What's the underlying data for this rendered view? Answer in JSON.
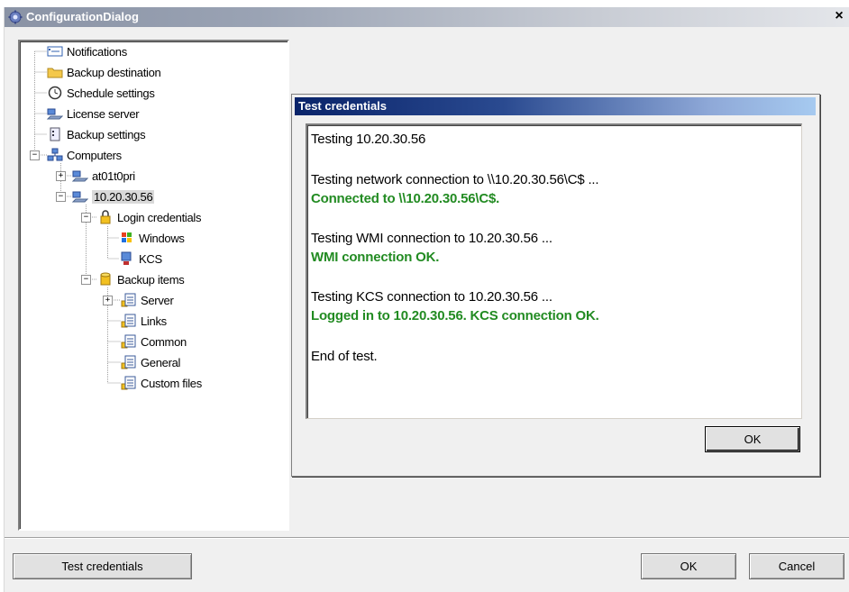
{
  "window": {
    "title": "ConfigurationDialog",
    "close_glyph": "×"
  },
  "tree": {
    "items": [
      {
        "label": "Notifications",
        "icon": "notifications-icon"
      },
      {
        "label": "Backup destination",
        "icon": "folder-icon"
      },
      {
        "label": "Schedule settings",
        "icon": "clock-icon"
      },
      {
        "label": "License server",
        "icon": "network-computer-icon"
      },
      {
        "label": "Backup settings",
        "icon": "settings-document-icon"
      },
      {
        "label": "Computers",
        "icon": "computers-icon"
      },
      {
        "label": "at01t0pri",
        "icon": "network-computer-icon"
      },
      {
        "label": "10.20.30.56",
        "icon": "network-computer-icon"
      },
      {
        "label": "Login credentials",
        "icon": "lock-icon"
      },
      {
        "label": "Windows",
        "icon": "windows-logo-icon"
      },
      {
        "label": "KCS",
        "icon": "kcs-computer-icon"
      },
      {
        "label": "Backup items",
        "icon": "database-icon"
      },
      {
        "label": "Server",
        "icon": "backup-list-icon"
      },
      {
        "label": "Links",
        "icon": "backup-list-icon"
      },
      {
        "label": "Common",
        "icon": "backup-list-icon"
      },
      {
        "label": "General",
        "icon": "backup-list-icon"
      },
      {
        "label": "Custom files",
        "icon": "backup-list-icon"
      }
    ],
    "selected": "10.20.30.56"
  },
  "test_dialog": {
    "title": "Test credentials",
    "lines": [
      {
        "text": "Testing 10.20.30.56",
        "status": "info"
      },
      {
        "text": "Testing network connection to \\\\10.20.30.56\\C$ ...",
        "status": "info"
      },
      {
        "text": "Connected to  \\\\10.20.30.56\\C$.",
        "status": "success"
      },
      {
        "text": "Testing WMI connection to 10.20.30.56 ...",
        "status": "info"
      },
      {
        "text": "WMI connection OK.",
        "status": "success"
      },
      {
        "text": "Testing KCS connection to 10.20.30.56 ...",
        "status": "info"
      },
      {
        "text": "Logged in to 10.20.30.56. KCS connection OK.",
        "status": "success"
      },
      {
        "text": "End of test.",
        "status": "info"
      }
    ],
    "ok_label": "OK",
    "success_color": "#228b22"
  },
  "footer": {
    "test_credentials_label": "Test credentials",
    "ok_label": "OK",
    "cancel_label": "Cancel"
  }
}
